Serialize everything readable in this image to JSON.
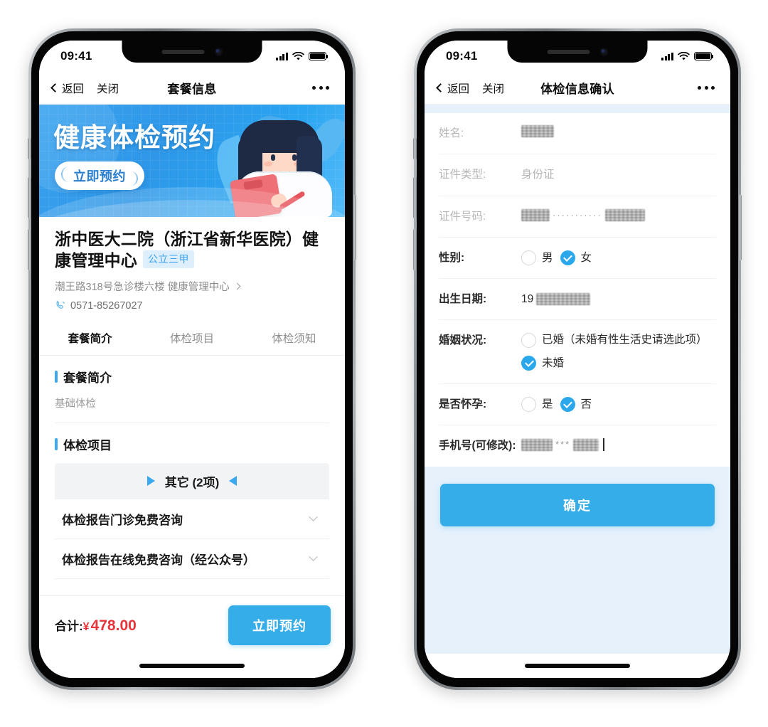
{
  "statusbar": {
    "time": "09:41",
    "signal_icon": "signal-bars-icon",
    "wifi_icon": "wifi-icon",
    "battery_icon": "battery-icon"
  },
  "left_phone": {
    "nav": {
      "back_label": "返回",
      "close_label": "关闭",
      "title": "套餐信息",
      "more_icon": "more-dots-icon"
    },
    "banner": {
      "title": "健康体检预约",
      "cta_label": "立即预约"
    },
    "hospital": {
      "name": "浙中医大二院（浙江省新华医院）健康管理中心",
      "badge": "公立三甲",
      "address": "潮王路318号急诊楼六楼 健康管理中心",
      "phone": "0571-85267027",
      "phone_icon": "phone-icon"
    },
    "tabs": [
      {
        "label": "套餐简介",
        "active": true
      },
      {
        "label": "体检项目",
        "active": false
      },
      {
        "label": "体检须知",
        "active": false
      }
    ],
    "sections": [
      {
        "title": "套餐简介",
        "body": "基础体检"
      },
      {
        "title": "体检项目"
      }
    ],
    "group": {
      "label": "其它 (2项)",
      "left_icon": "triangle-right-icon",
      "right_icon": "triangle-left-icon"
    },
    "items": [
      {
        "label": "体检报告门诊免费咨询",
        "chevron": "chevron-down-icon"
      },
      {
        "label": "体检报告在线免费咨询（经公众号）",
        "chevron": "chevron-down-icon"
      }
    ],
    "footer": {
      "total_label": "合计:",
      "currency": "¥",
      "amount": "478.00",
      "book_label": "立即预约"
    }
  },
  "right_phone": {
    "nav": {
      "back_label": "返回",
      "close_label": "关闭",
      "title": "体检信息确认",
      "more_icon": "more-dots-icon"
    },
    "form": [
      {
        "label": "姓名:",
        "label_muted": true,
        "value_type": "redacted"
      },
      {
        "label": "证件类型:",
        "label_muted": true,
        "value_type": "text",
        "value": "身份证"
      },
      {
        "label": "证件号码:",
        "label_muted": true,
        "value_type": "redacted-masked",
        "mask": "···········"
      },
      {
        "label": "性别:",
        "label_muted": false,
        "value_type": "radio-inline",
        "options": [
          {
            "label": "男",
            "selected": false
          },
          {
            "label": "女",
            "selected": true
          }
        ]
      },
      {
        "label": "出生日期:",
        "label_muted": false,
        "value_type": "prefix-redacted",
        "prefix": "19"
      },
      {
        "label": "婚姻状况:",
        "label_muted": false,
        "value_type": "radio-stack",
        "options": [
          {
            "label": "已婚（未婚有性生活史请选此项）",
            "selected": false
          },
          {
            "label": "未婚",
            "selected": true
          }
        ]
      },
      {
        "label": "是否怀孕:",
        "label_muted": false,
        "value_type": "radio-inline",
        "options": [
          {
            "label": "是",
            "selected": false
          },
          {
            "label": "否",
            "selected": true
          }
        ]
      },
      {
        "label": "手机号(可修改):",
        "label_muted": false,
        "value_type": "redacted-phone",
        "mask": "***"
      }
    ],
    "confirm_label": "确定"
  },
  "colors": {
    "accent_blue": "#35ade9",
    "banner_blue": "#2e97e8",
    "price_red": "#e8353b",
    "badge_bg": "#ddeefc",
    "badge_text": "#3ba4ef",
    "page_bg": "#e6f1fc"
  }
}
